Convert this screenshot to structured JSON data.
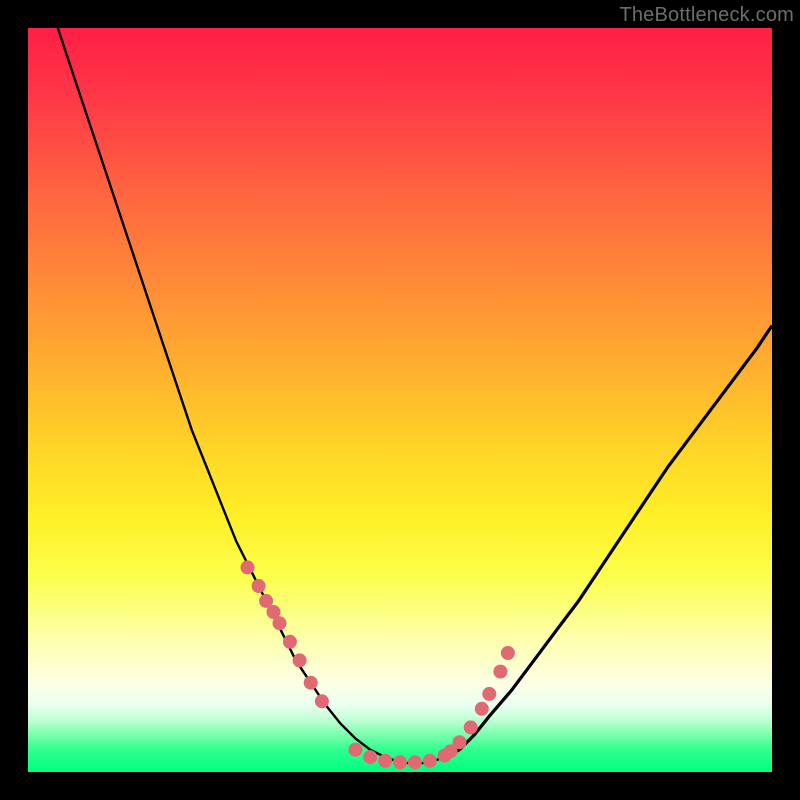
{
  "watermark": "TheBottleneck.com",
  "colors": {
    "background": "#000000",
    "curve_stroke": "#000000",
    "marker_fill": "#e06973",
    "marker_stroke": "#c9535e",
    "gradient_top": "#ff1e46",
    "gradient_bottom": "#00ff7e"
  },
  "chart_data": {
    "type": "line",
    "title": "",
    "xlabel": "",
    "ylabel": "",
    "xlim": [
      0,
      100
    ],
    "ylim": [
      0,
      100
    ],
    "grid": false,
    "legend": false,
    "annotations": [],
    "series": [
      {
        "name": "bottleneck-curve",
        "x": [
          4,
          6,
          8,
          10,
          12,
          14,
          16,
          18,
          20,
          22,
          24,
          26,
          28,
          30,
          32,
          34,
          36,
          38,
          40,
          42,
          44,
          46,
          48,
          50,
          52,
          54,
          56,
          58,
          60,
          62,
          65,
          68,
          71,
          74,
          77,
          80,
          83,
          86,
          89,
          92,
          95,
          98,
          100
        ],
        "y": [
          100,
          94,
          88,
          82,
          76,
          70,
          64,
          58,
          52,
          46,
          41,
          36,
          31,
          27,
          23,
          19,
          15,
          12,
          9,
          6.5,
          4.5,
          3,
          2,
          1.3,
          1.1,
          1.3,
          2,
          3,
          5,
          7.5,
          11,
          15,
          19,
          23,
          27.5,
          32,
          36.5,
          41,
          45,
          49,
          53,
          57,
          60
        ]
      }
    ],
    "markers": {
      "name": "highlight-dots",
      "x": [
        29.5,
        31,
        32,
        33,
        33.8,
        35.2,
        36.5,
        38,
        39.5,
        44,
        46,
        48,
        50,
        52,
        54,
        56,
        56.8,
        58,
        59.5,
        61,
        62,
        63.5,
        64.5
      ],
      "y": [
        27.5,
        25,
        23,
        21.5,
        20,
        17.5,
        15,
        12,
        9.5,
        3,
        2,
        1.5,
        1.3,
        1.3,
        1.5,
        2.2,
        2.8,
        4,
        6,
        8.5,
        10.5,
        13.5,
        16
      ]
    }
  }
}
